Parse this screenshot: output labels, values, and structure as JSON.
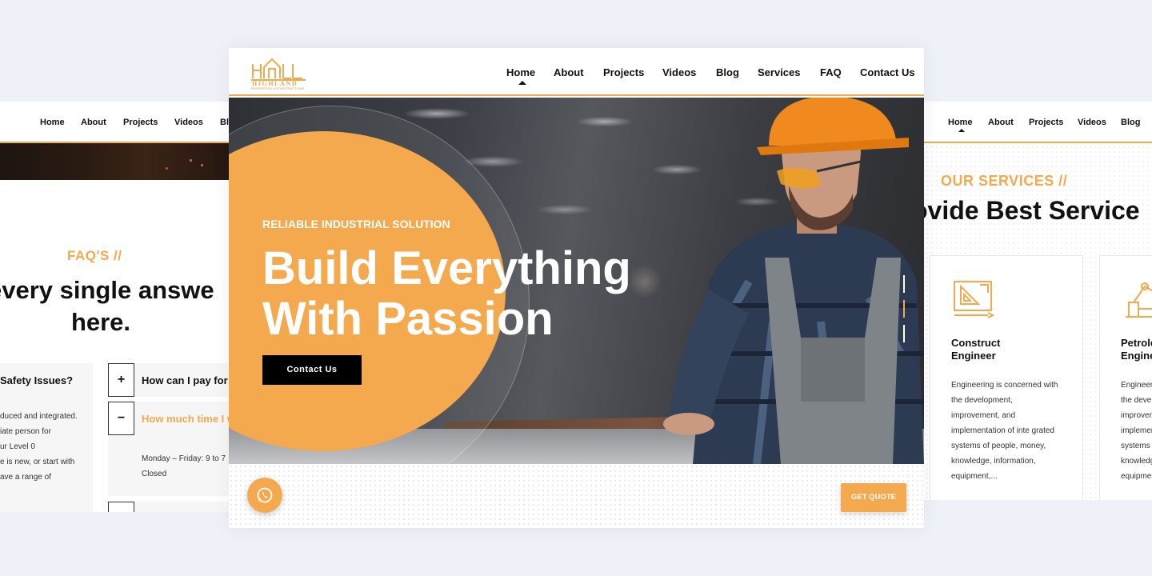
{
  "colors": {
    "accent": "#f4a94e",
    "background": "#eef2f8",
    "dark": "#111111"
  },
  "left_page": {
    "nav": [
      "Home",
      "About",
      "Projects",
      "Videos",
      "Bl"
    ],
    "faq_tag": "FAQ'S //",
    "heading_line1": "every single answe",
    "heading_line2": "here.",
    "left_card": {
      "question": "Safety Issues?",
      "answer": "duced and integrated.\niate person for\nur Level 0\ne is new, or start with\nave a range of"
    },
    "faq_items": [
      {
        "toggle": "+",
        "question": "How can I pay for m"
      },
      {
        "toggle": "−",
        "question": "How much time I w",
        "answer": "Monday – Friday: 9 to 7\nClosed"
      },
      {
        "toggle": ""
      }
    ]
  },
  "main_page": {
    "logo": {
      "name": "HIGHLAND",
      "tagline": "PROPERTIES & CONSTRUCTIONS"
    },
    "nav": [
      "Home",
      "About",
      "Projects",
      "Videos",
      "Blog",
      "Services",
      "FAQ",
      "Contact Us"
    ],
    "hero": {
      "eyebrow": "RELIABLE INDUSTRIAL SOLUTION",
      "title": "Build Everything\nWith Passion",
      "cta": "Contact Us"
    },
    "whatsapp_icon": "whatsapp-icon",
    "get_quote": "GET QUOTE"
  },
  "right_page": {
    "nav": [
      "Home",
      "About",
      "Projects",
      "Videos",
      "Blog"
    ],
    "services_tag": "OUR SERVICES //",
    "heading": "ovide Best Service",
    "cards": [
      {
        "icon": "blueprint-icon",
        "title": "Construct\nEngineer",
        "text": "Engineering is concerned with\nthe development,\nimprovement, and\nimplementation of inte grated\nsystems of people, money,\nknowledge, information,\nequipment,..."
      },
      {
        "icon": "oil-pump-icon",
        "title": "Petrole\nEngine",
        "text": "Engineer\nthe devel\nimprover\nimplemer\nsystems\nknowledg\nequipmen"
      }
    ]
  }
}
